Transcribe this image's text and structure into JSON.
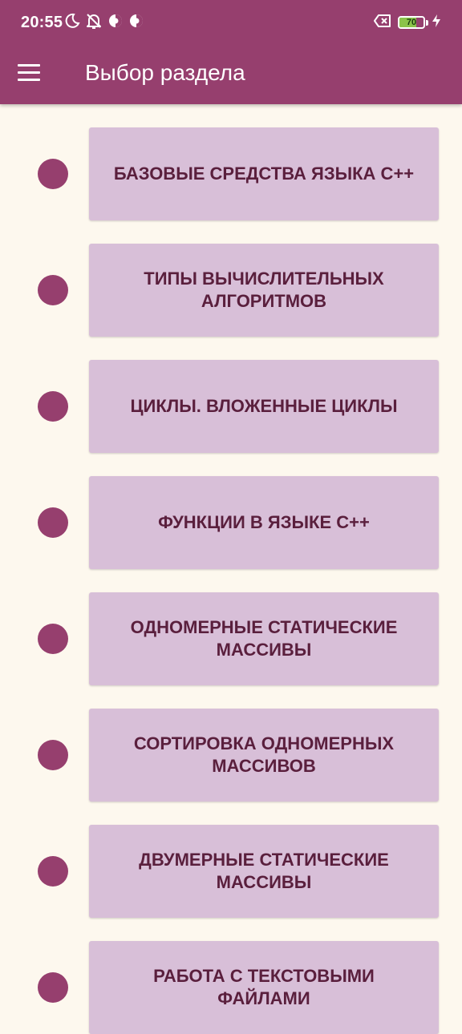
{
  "status_bar": {
    "time": "20:55",
    "battery_level": "70",
    "battery_fill_percent": 70,
    "icons": [
      "moon-icon",
      "bell-off-icon",
      "data-saver-icon",
      "data-saver-icon",
      "battery-saver-icon",
      "battery-icon",
      "charging-bolt-icon"
    ]
  },
  "app_bar": {
    "menu_icon": "hamburger-menu-icon",
    "title": "Выбор раздела"
  },
  "colors": {
    "primary": "#963f6e",
    "card": "#d8bfd8",
    "card_text": "#5a1f3d",
    "background": "#fdf8ee"
  },
  "sections": [
    {
      "label": "БАЗОВЫЕ СРЕДСТВА ЯЗЫКА С++"
    },
    {
      "label": "ТИПЫ ВЫЧИСЛИТЕЛЬНЫХ\nАЛГОРИТМОВ"
    },
    {
      "label": "ЦИКЛЫ. ВЛОЖЕННЫЕ ЦИКЛЫ"
    },
    {
      "label": "ФУНКЦИИ В ЯЗЫКЕ С++"
    },
    {
      "label": "ОДНОМЕРНЫЕ СТАТИЧЕСКИЕ\nМАССИВЫ"
    },
    {
      "label": "СОРТИРОВКА ОДНОМЕРНЫХ\nМАССИВОВ"
    },
    {
      "label": "ДВУМЕРНЫЕ СТАТИЧЕСКИЕ\nМАССИВЫ"
    },
    {
      "label": "РАБОТА С ТЕКСТОВЫМИ\nФАЙЛАМИ"
    }
  ]
}
